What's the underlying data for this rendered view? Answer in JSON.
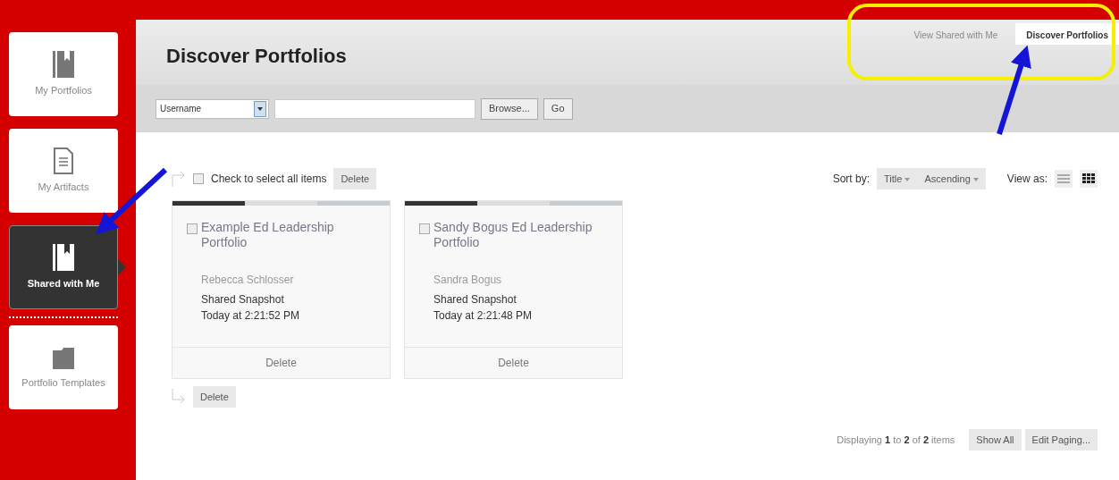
{
  "sidebar": {
    "items": [
      {
        "label": "My Portfolios",
        "kind": "book",
        "selected": false
      },
      {
        "label": "My Artifacts",
        "kind": "document",
        "selected": false
      },
      {
        "label": "Shared with Me",
        "kind": "book",
        "selected": true
      },
      {
        "label": "Portfolio Templates",
        "kind": "folder",
        "selected": false
      }
    ]
  },
  "header": {
    "title": "Discover Portfolios",
    "tabs": [
      {
        "label": "View Shared with Me",
        "selected": false
      },
      {
        "label": "Discover Portfolios",
        "selected": true
      }
    ]
  },
  "search": {
    "field": "Username",
    "buttons": [
      "Browse...",
      "Go"
    ]
  },
  "list_controls": {
    "select_all_label": "Check to select all items",
    "select_all_checked": false,
    "delete": "Delete",
    "sort_label": "Sort by:",
    "sort_field": "Title",
    "sort_order": "Ascending",
    "view_label": "View as:",
    "views": [
      {
        "kind": "list",
        "selected": false
      },
      {
        "kind": "grid",
        "selected": true
      }
    ]
  },
  "cards": [
    {
      "title": "Example Ed Leadership Portfolio",
      "checked": false,
      "owner": "Rebecca Schlosser",
      "type": "Shared Snapshot",
      "time": "Today at 2:21:52 PM",
      "action": "Delete"
    },
    {
      "title": "Sandy Bogus Ed Leadership Portfolio",
      "checked": false,
      "owner": "Sandra Bogus",
      "type": "Shared Snapshot",
      "time": "Today at 2:21:48 PM",
      "action": "Delete"
    }
  ],
  "bottom_delete": "Delete",
  "paging": {
    "text": "Displaying **1** to **2** of **2** items",
    "buttons": [
      "Show All",
      "Edit Paging..."
    ]
  }
}
